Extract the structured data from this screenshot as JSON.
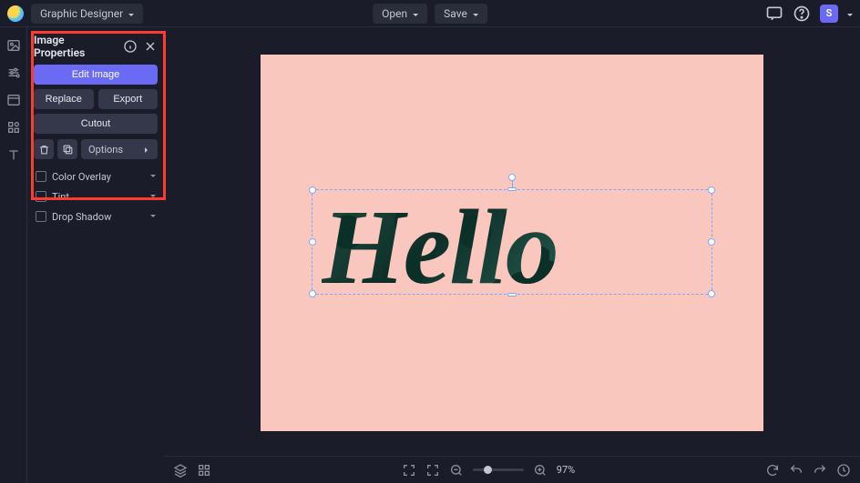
{
  "header": {
    "app_mode": "Graphic Designer",
    "open_label": "Open",
    "save_label": "Save",
    "avatar_initial": "S"
  },
  "panel": {
    "title": "Image Properties",
    "edit_image": "Edit Image",
    "replace": "Replace",
    "export": "Export",
    "cutout": "Cutout",
    "options": "Options",
    "color_overlay": "Color Overlay",
    "tint": "Tint",
    "drop_shadow": "Drop Shadow"
  },
  "canvas": {
    "hello_text": "Hello",
    "artboard_bg": "#f9c7bd"
  },
  "bottombar": {
    "zoom_percent": "97%"
  }
}
